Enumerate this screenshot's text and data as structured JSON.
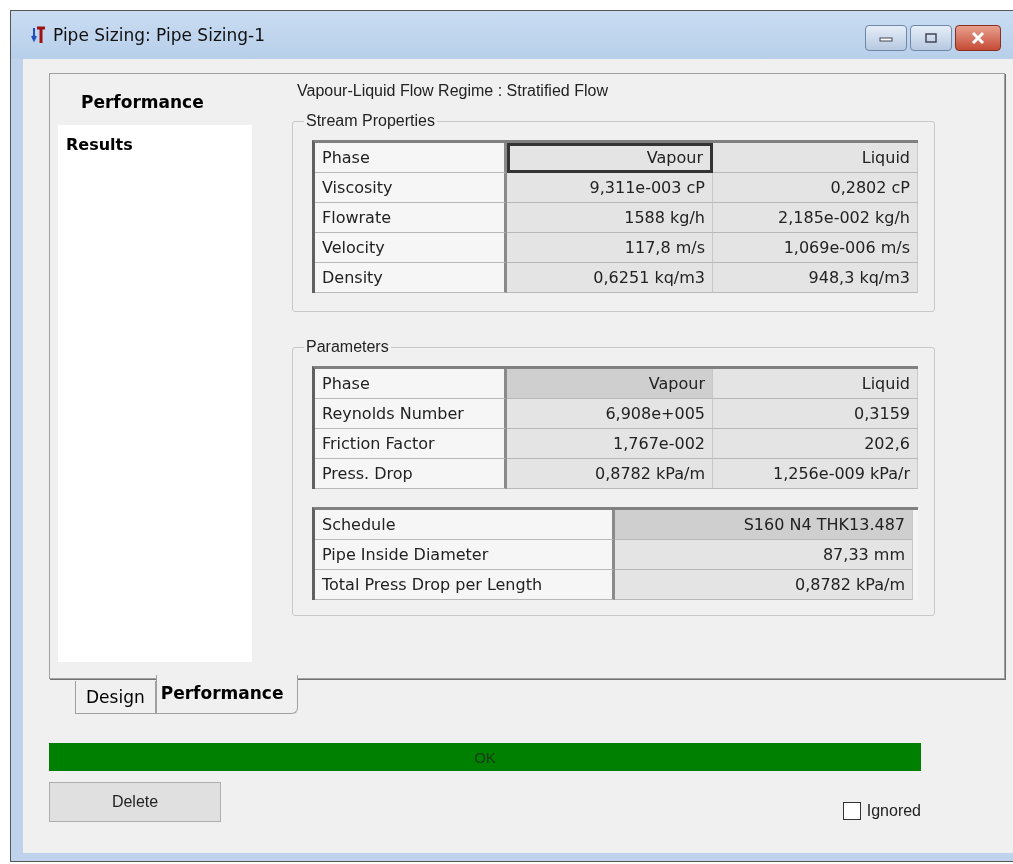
{
  "window": {
    "title": "Pipe Sizing: Pipe Sizing-1"
  },
  "sidebar": {
    "header": "Performance",
    "items": [
      {
        "label": "Results",
        "selected": true
      }
    ]
  },
  "flow_regime": "Vapour-Liquid Flow Regime : Stratified Flow",
  "groups": [
    {
      "title": "Stream Properties",
      "tables": [
        {
          "columns": [
            {
              "label": "Phase",
              "focused": false,
              "highlighted": false
            },
            {
              "label": "Vapour",
              "focused": true,
              "highlighted": false
            },
            {
              "label": "Liquid",
              "focused": false,
              "highlighted": false
            }
          ],
          "rows": [
            [
              "Viscosity",
              "9,311e-003 cP",
              "0,2802 cP"
            ],
            [
              "Flowrate",
              "1588 kg/h",
              "2,185e-002 kg/h"
            ],
            [
              "Velocity",
              "117,8 m/s",
              "1,069e-006 m/s"
            ],
            [
              "Density",
              "0,6251 kq/m3",
              "948,3 kq/m3"
            ]
          ]
        }
      ]
    },
    {
      "title": "Parameters",
      "tables": [
        {
          "columns": [
            {
              "label": "Phase",
              "focused": false,
              "highlighted": false
            },
            {
              "label": "Vapour",
              "focused": false,
              "highlighted": true
            },
            {
              "label": "Liquid",
              "focused": false,
              "highlighted": false
            }
          ],
          "rows": [
            [
              "Reynolds Number",
              "6,908e+005",
              "0,3159"
            ],
            [
              "Friction Factor",
              "1,767e-002",
              "202,6"
            ],
            [
              "Press. Drop",
              "0,8782 kPa/m",
              "1,256e-009 kPa/r"
            ]
          ]
        },
        {
          "columns": [
            {
              "label": "Schedule",
              "focused": false,
              "highlighted": false
            },
            {
              "label": "S160 N4 THK13.487",
              "focused": false,
              "highlighted": true
            }
          ],
          "rows": [
            [
              "Pipe Inside Diameter",
              "87,33 mm"
            ],
            [
              "Total Press Drop per Length",
              "0,8782 kPa/m"
            ]
          ]
        }
      ]
    }
  ],
  "tabs": [
    {
      "label": "Design",
      "selected": false
    },
    {
      "label": "Performance",
      "selected": true
    }
  ],
  "status": {
    "text": "OK",
    "kind": "ok"
  },
  "buttons": [
    {
      "label": "Delete"
    }
  ],
  "ignored": {
    "label": "Ignored",
    "checked": false
  }
}
